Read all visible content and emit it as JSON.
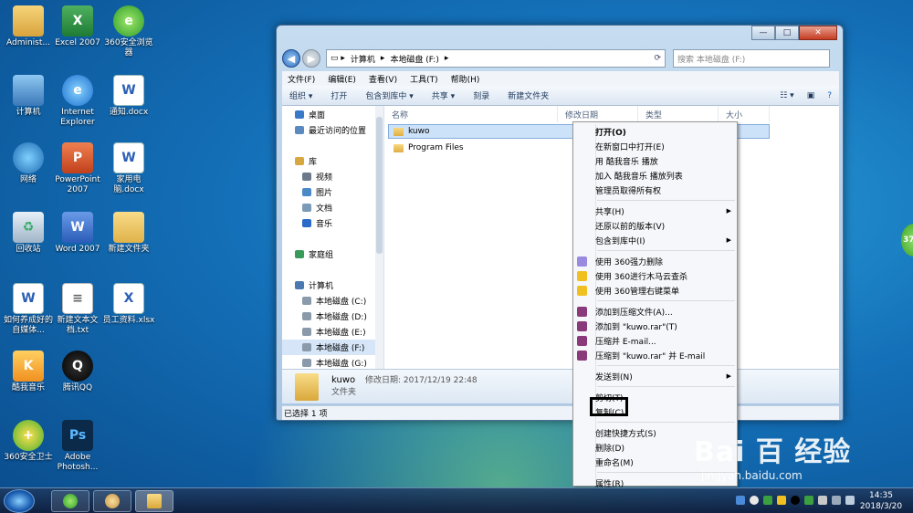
{
  "desktop": {
    "icons": [
      {
        "label": "Administ...",
        "glyph": "",
        "cls": "user"
      },
      {
        "label": "Excel 2007",
        "glyph": "X",
        "cls": "excel"
      },
      {
        "label": "360安全浏览器",
        "glyph": "e",
        "cls": "browser360"
      },
      {
        "label": "计算机",
        "glyph": "",
        "cls": "computer"
      },
      {
        "label": "Internet Explorer",
        "glyph": "e",
        "cls": "ie"
      },
      {
        "label": "通知.docx",
        "glyph": "W",
        "cls": "doc"
      },
      {
        "label": "网络",
        "glyph": "",
        "cls": "network"
      },
      {
        "label": "PowerPoint 2007",
        "glyph": "P",
        "cls": "ppt"
      },
      {
        "label": "家用电脑.docx",
        "glyph": "W",
        "cls": "doc"
      },
      {
        "label": "回收站",
        "glyph": "♻",
        "cls": "recycle"
      },
      {
        "label": "Word 2007",
        "glyph": "W",
        "cls": "word"
      },
      {
        "label": "新建文件夹",
        "glyph": "",
        "cls": "folder"
      },
      {
        "label": "如何养成好的自媒体...",
        "glyph": "W",
        "cls": "doc"
      },
      {
        "label": "新建文本文档.txt",
        "glyph": "≡",
        "cls": "txt"
      },
      {
        "label": "员工资料.xlsx",
        "glyph": "X",
        "cls": "doc"
      },
      {
        "label": "酷我音乐",
        "glyph": "K",
        "cls": "kuwo"
      },
      {
        "label": "腾讯QQ",
        "glyph": "Q",
        "cls": "qq"
      },
      {
        "label": "360安全卫士",
        "glyph": "+",
        "cls": "safe360"
      },
      {
        "label": "Adobe Photosh...",
        "glyph": "Ps",
        "cls": "ps"
      }
    ]
  },
  "window": {
    "breadcrumb": [
      "计算机",
      "本地磁盘 (F:)"
    ],
    "search_placeholder": "搜索 本地磁盘 (F:)",
    "menu": [
      "文件(F)",
      "编辑(E)",
      "查看(V)",
      "工具(T)",
      "帮助(H)"
    ],
    "toolbar": [
      "组织 ▾",
      "打开",
      "包含到库中 ▾",
      "共享 ▾",
      "刻录",
      "新建文件夹"
    ],
    "nav": [
      {
        "label": "桌面",
        "color": "#3a78c8"
      },
      {
        "label": "最近访问的位置",
        "color": "#5a8ac0"
      },
      {
        "label": "",
        "color": ""
      },
      {
        "label": "库",
        "color": "#d8a840"
      },
      {
        "label": "视频",
        "color": "#6a7a8a"
      },
      {
        "label": "图片",
        "color": "#4a8ac8"
      },
      {
        "label": "文档",
        "color": "#7a9ab8"
      },
      {
        "label": "音乐",
        "color": "#2a6ac8"
      },
      {
        "label": "",
        "color": ""
      },
      {
        "label": "家庭组",
        "color": "#3a9a5a"
      },
      {
        "label": "",
        "color": ""
      },
      {
        "label": "计算机",
        "color": "#4a7ab0"
      },
      {
        "label": "本地磁盘 (C:)",
        "color": "#8a9aaa"
      },
      {
        "label": "本地磁盘 (D:)",
        "color": "#8a9aaa"
      },
      {
        "label": "本地磁盘 (E:)",
        "color": "#8a9aaa"
      },
      {
        "label": "本地磁盘 (F:)",
        "color": "#8a9aaa",
        "selected": true
      },
      {
        "label": "本地磁盘 (G:)",
        "color": "#8a9aaa"
      }
    ],
    "columns": [
      "名称",
      "修改日期",
      "类型",
      "大小"
    ],
    "files": [
      {
        "name": "kuwo",
        "selected": true
      },
      {
        "name": "Program Files",
        "selected": false
      }
    ],
    "details": {
      "name": "kuwo",
      "modified": "修改日期: 2017/12/19 22:48",
      "type": "文件夹"
    },
    "status": "已选择 1 项"
  },
  "context_menu": [
    {
      "label": "打开(O)",
      "bold": true
    },
    {
      "label": "在新窗口中打开(E)"
    },
    {
      "label": "用 酷我音乐 播放"
    },
    {
      "label": "加入 酷我音乐 播放列表"
    },
    {
      "label": "管理员取得所有权"
    },
    {
      "sep": true
    },
    {
      "label": "共享(H)",
      "submenu": true
    },
    {
      "label": "还原以前的版本(V)"
    },
    {
      "label": "包含到库中(I)",
      "submenu": true
    },
    {
      "sep": true
    },
    {
      "label": "使用 360强力删除",
      "icon": "#9a8ae0"
    },
    {
      "label": "使用 360进行木马云查杀",
      "icon": "#f0c020"
    },
    {
      "label": "使用 360管理右键菜单",
      "icon": "#f0c020"
    },
    {
      "sep": true
    },
    {
      "label": "添加到压缩文件(A)...",
      "icon": "#8a3a7a"
    },
    {
      "label": "添加到 \"kuwo.rar\"(T)",
      "icon": "#8a3a7a"
    },
    {
      "label": "压缩并 E-mail...",
      "icon": "#8a3a7a"
    },
    {
      "label": "压缩到 \"kuwo.rar\" 并 E-mail",
      "icon": "#8a3a7a"
    },
    {
      "sep": true
    },
    {
      "label": "发送到(N)",
      "submenu": true
    },
    {
      "sep": true
    },
    {
      "label": "剪切(T)"
    },
    {
      "label": "复制(C)"
    },
    {
      "sep": true
    },
    {
      "label": "创建快捷方式(S)"
    },
    {
      "label": "删除(D)"
    },
    {
      "label": "重命名(M)"
    },
    {
      "sep": true
    },
    {
      "label": "属性(R)"
    }
  ],
  "taskbar": {
    "time": "14:35",
    "date": "2018/3/20"
  },
  "badge": "37",
  "watermark": {
    "title": "Bai  百  经验",
    "url": "jingyan.baidu.com"
  }
}
